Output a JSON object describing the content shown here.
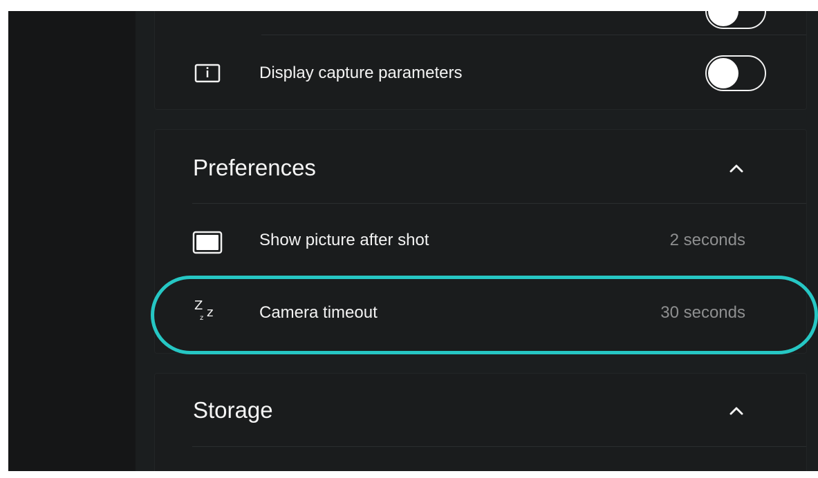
{
  "top_card": {
    "display_capture_parameters": {
      "label": "Display capture parameters",
      "icon": "info-frame-icon",
      "toggle_on": false
    },
    "previous_toggle": {
      "toggle_on": false
    }
  },
  "preferences": {
    "title": "Preferences",
    "chevron_icon": "chevron-up-icon",
    "items": [
      {
        "label": "Show picture after shot",
        "value": "2 seconds",
        "icon": "picture-frame-icon"
      },
      {
        "label": "Camera timeout",
        "value": "30 seconds",
        "icon": "sleep-zz-icon"
      }
    ]
  },
  "storage": {
    "title": "Storage",
    "chevron_icon": "chevron-up-icon"
  },
  "highlight": {
    "color": "#26c7c4",
    "target": "camera-timeout-row"
  },
  "colors": {
    "background": "#17191a",
    "panel": "#1a1c1d",
    "text": "#f3f3f3",
    "muted_text": "#8e8f90",
    "accent": "#26c7c4"
  }
}
